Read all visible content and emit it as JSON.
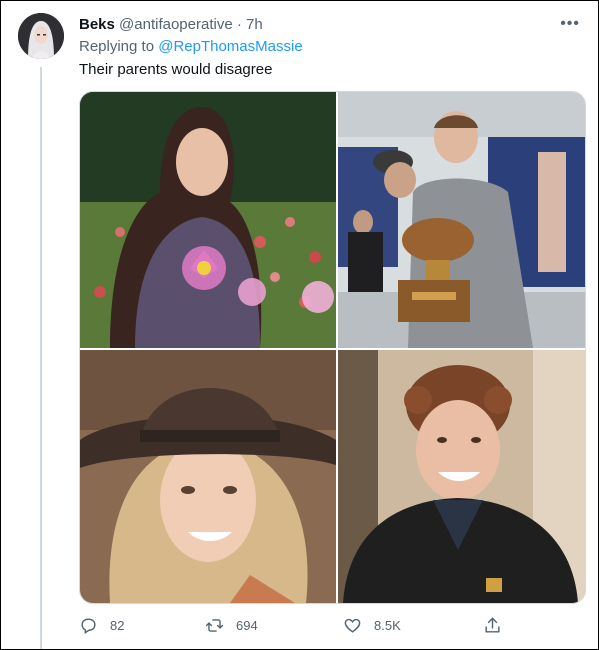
{
  "tweet": {
    "author_name": "Beks",
    "author_handle": "@antifaoperative",
    "separator": "·",
    "time": "7h",
    "more_icon": "more-icon",
    "replying_prefix": "Replying to",
    "replying_to": "@RepThomasMassie",
    "text": "Their parents would disagree"
  },
  "media": {
    "photos": [
      "photo-girl-flowers",
      "photo-boy-trophy",
      "photo-girl-hat",
      "photo-boy-jacket"
    ]
  },
  "actions": {
    "reply_count": "82",
    "retweet_count": "694",
    "like_count": "8.5K",
    "reply_icon": "reply-icon",
    "retweet_icon": "retweet-icon",
    "like_icon": "heart-icon",
    "share_icon": "share-icon"
  },
  "colors": {
    "link": "#1d9bf0",
    "secondary_text": "#536471",
    "thread_line": "#cfd9de"
  }
}
